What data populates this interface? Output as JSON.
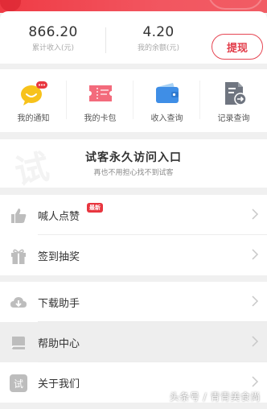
{
  "wallet": {
    "total_income": "866.20",
    "total_income_label": "累计收入(元)",
    "balance": "4.20",
    "balance_label": "我的余额(元)",
    "withdraw_label": "提现"
  },
  "quick_menu": [
    {
      "label": "我的通知",
      "icon": "chat-bubble-icon"
    },
    {
      "label": "我的卡包",
      "icon": "ticket-icon"
    },
    {
      "label": "收入查询",
      "icon": "wallet-icon"
    },
    {
      "label": "记录查询",
      "icon": "document-arrow-icon"
    }
  ],
  "promo": {
    "watermark": "试",
    "title": "试客永久访问入口",
    "subtitle": "再也不用担心找不到试客"
  },
  "menu_group_1": [
    {
      "label": "喊人点赞",
      "icon": "thumbs-up-icon",
      "badge": "最新"
    },
    {
      "label": "签到抽奖",
      "icon": "gift-icon"
    }
  ],
  "menu_group_2": [
    {
      "label": "下载助手",
      "icon": "cloud-download-icon"
    },
    {
      "label": "帮助中心",
      "icon": "book-icon"
    },
    {
      "label": "关于我们",
      "icon": "info-badge-icon",
      "icon_text": "试"
    }
  ],
  "watermark": "头条号 / 青青美食尚",
  "colors": {
    "accent": "#e23b48",
    "banner": "#ef3b45"
  }
}
